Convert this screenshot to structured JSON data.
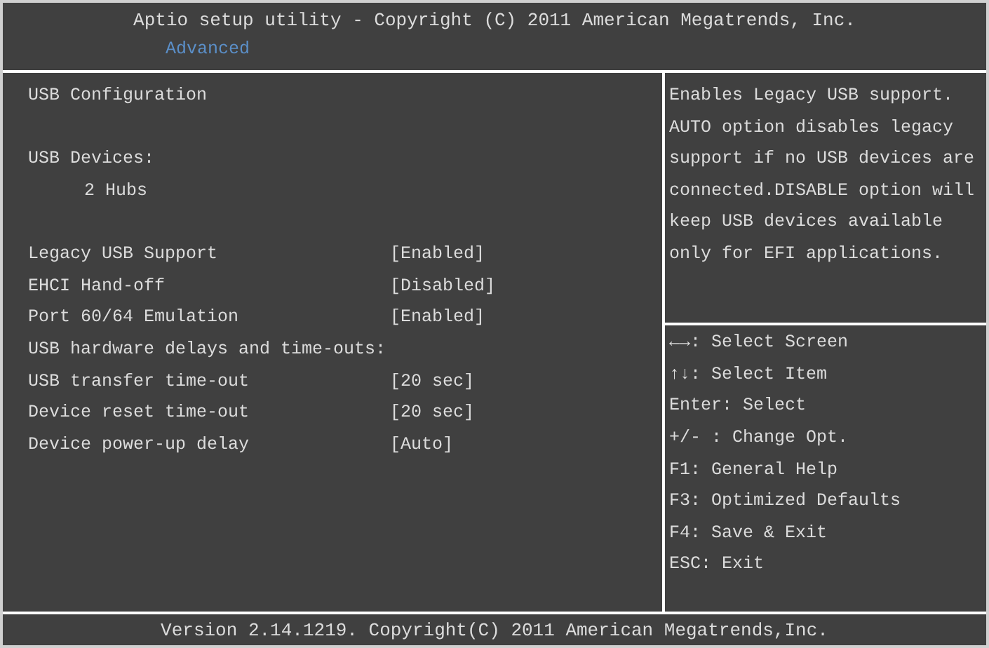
{
  "header": {
    "title": "Aptio setup utility - Copyright (C) 2011 American Megatrends, Inc.",
    "tabs": [
      {
        "label": "Advanced",
        "selected": true
      }
    ]
  },
  "items": [
    {
      "kind": "heading",
      "label": "USB Configuration"
    },
    {
      "kind": "spacer"
    },
    {
      "kind": "heading",
      "label": "USB Devices:"
    },
    {
      "kind": "info",
      "label": "2 Hubs"
    },
    {
      "kind": "spacer"
    },
    {
      "kind": "setting",
      "label": "Legacy USB Support",
      "value": "[Enabled]"
    },
    {
      "kind": "setting",
      "label": "EHCI Hand-off",
      "value": "[Disabled]"
    },
    {
      "kind": "setting",
      "label": "Port 60/64 Emulation",
      "value": "[Enabled]"
    },
    {
      "kind": "heading",
      "label": "USB hardware delays and time-outs:"
    },
    {
      "kind": "setting",
      "label": "USB transfer time-out",
      "value": "[20 sec]"
    },
    {
      "kind": "setting",
      "label": "Device reset time-out",
      "value": "[20 sec]"
    },
    {
      "kind": "setting",
      "label": "Device power-up delay",
      "value": "[Auto]"
    }
  ],
  "help_text": "Enables Legacy USB support. AUTO option disables legacy support if no USB devices are connected.DISABLE option will keep USB devices available only for EFI applications.",
  "key_hints": [
    "←→: Select Screen",
    "↑↓: Select Item",
    "Enter: Select",
    "+/- : Change Opt.",
    "F1: General Help",
    "F3: Optimized Defaults",
    "F4: Save & Exit",
    "ESC: Exit"
  ],
  "footer": "Version 2.14.1219. Copyright(C) 2011 American Megatrends,Inc."
}
